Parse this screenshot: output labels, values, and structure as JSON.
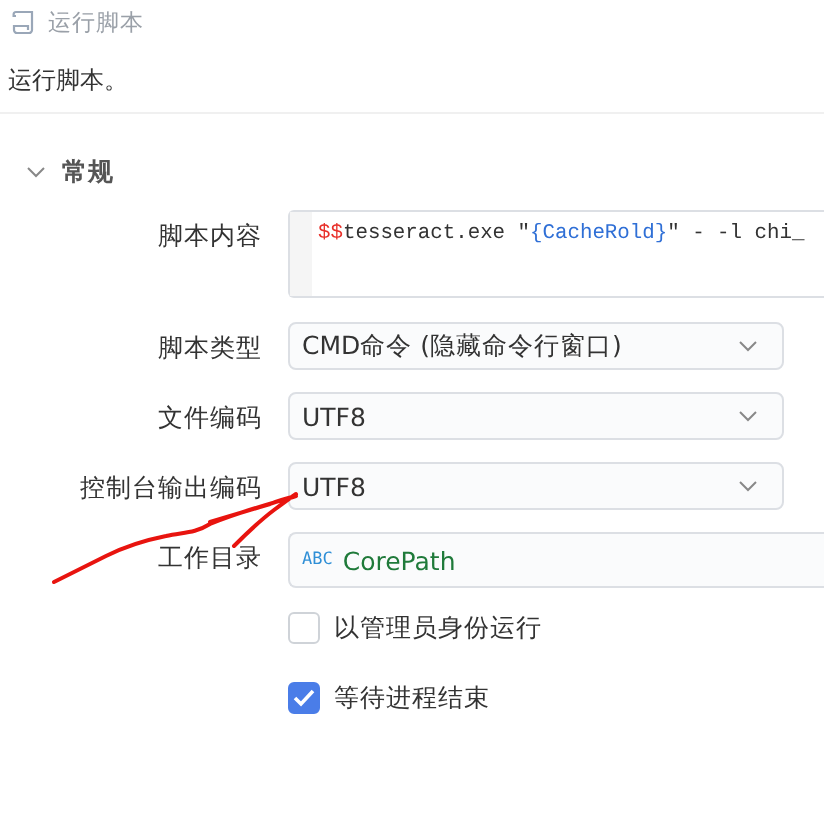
{
  "header": {
    "title": "运行脚本"
  },
  "description": "运行脚本。",
  "section": {
    "title": "常规",
    "expanded": true
  },
  "script": {
    "label": "脚本内容",
    "tokens": [
      {
        "text": "$$",
        "kind": "variable"
      },
      {
        "text": "tesseract.exe \"",
        "kind": "plain"
      },
      {
        "text": "{CacheRold}",
        "kind": "reference"
      },
      {
        "text": "\" - -l chi_",
        "kind": "plain"
      }
    ]
  },
  "selects": [
    {
      "label": "脚本类型",
      "value": "CMD命令 (隐藏命令行窗口)"
    },
    {
      "label": "文件编码",
      "value": "UTF8"
    },
    {
      "label": "控制台输出编码",
      "value": "UTF8"
    }
  ],
  "workdir": {
    "label": "工作目录",
    "badge": "ABC",
    "value": "CorePath"
  },
  "checkboxes": [
    {
      "label": "以管理员身份运行",
      "checked": false
    },
    {
      "label": "等待进程结束",
      "checked": true
    }
  ],
  "annotation": {
    "kind": "scribble"
  }
}
